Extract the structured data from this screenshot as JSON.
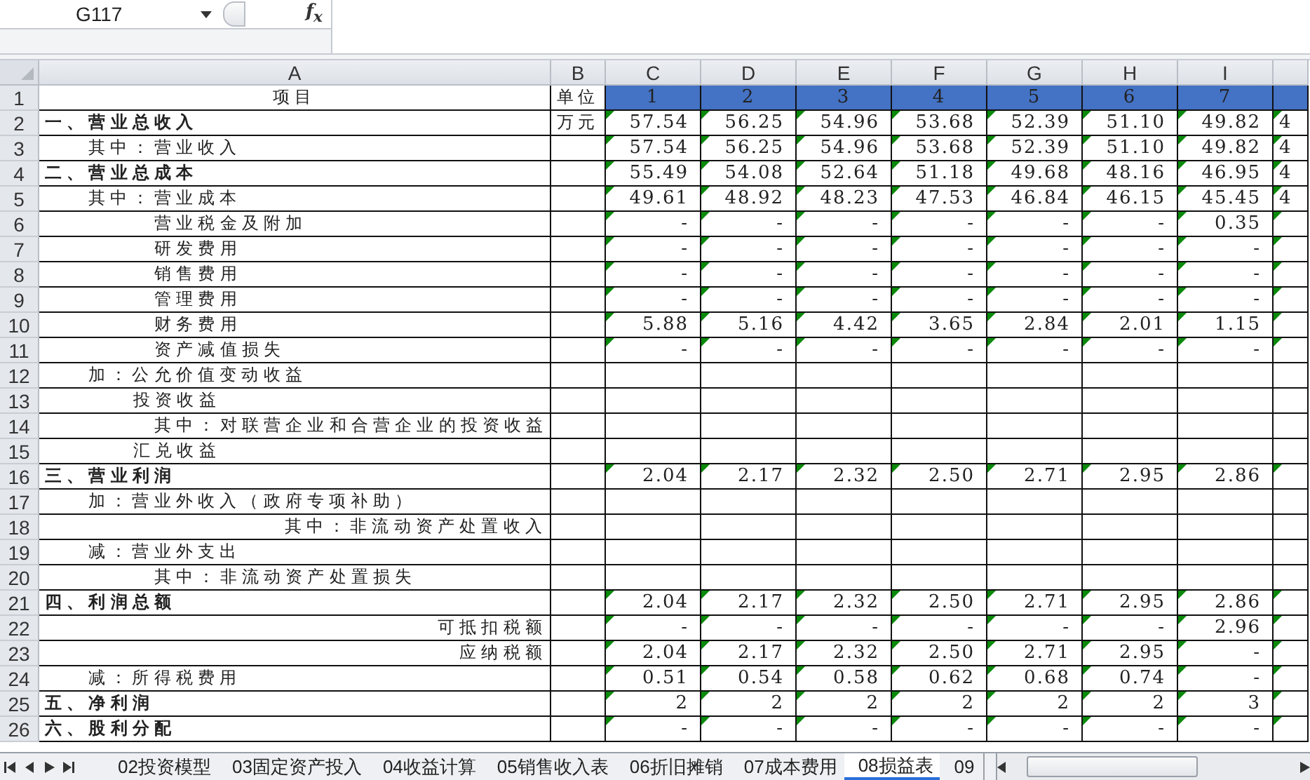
{
  "formula_bar": {
    "name_box": "G117",
    "function_label": "f$_{x}$"
  },
  "columns": [
    "A",
    "B",
    "C",
    "D",
    "E",
    "F",
    "G",
    "H",
    "I"
  ],
  "rows": [
    {
      "num": "1",
      "label": "项目",
      "kind": "header",
      "unit": "单位",
      "values": [
        "1",
        "2",
        "3",
        "4",
        "5",
        "6",
        "7"
      ],
      "flagged": false
    },
    {
      "num": "2",
      "label": "一、营业总收入",
      "kind": "heading",
      "unit": "万元",
      "values": [
        "57.54",
        "56.25",
        "54.96",
        "53.68",
        "52.39",
        "51.10",
        "49.82"
      ],
      "column_j": "4",
      "flagged": true
    },
    {
      "num": "3",
      "label": "其中：营业收入",
      "kind": "level1",
      "values": [
        "57.54",
        "56.25",
        "54.96",
        "53.68",
        "52.39",
        "51.10",
        "49.82"
      ],
      "column_j": "4",
      "flagged": true
    },
    {
      "num": "4",
      "label": "二、营业总成本",
      "kind": "heading",
      "values": [
        "55.49",
        "54.08",
        "52.64",
        "51.18",
        "49.68",
        "48.16",
        "46.95"
      ],
      "column_j": "4",
      "flagged": true
    },
    {
      "num": "5",
      "label": "其中：营业成本",
      "kind": "level1",
      "values": [
        "49.61",
        "48.92",
        "48.23",
        "47.53",
        "46.84",
        "46.15",
        "45.45"
      ],
      "column_j": "4",
      "flagged": true
    },
    {
      "num": "6",
      "label": "营业税金及附加",
      "kind": "level3",
      "values": [
        "-",
        "-",
        "-",
        "-",
        "-",
        "-",
        "0.35"
      ],
      "flagged": true
    },
    {
      "num": "7",
      "label": "研发费用",
      "kind": "level3",
      "values": [
        "-",
        "-",
        "-",
        "-",
        "-",
        "-",
        "-"
      ],
      "flagged": true
    },
    {
      "num": "8",
      "label": "销售费用",
      "kind": "level3",
      "values": [
        "-",
        "-",
        "-",
        "-",
        "-",
        "-",
        "-"
      ],
      "flagged": true
    },
    {
      "num": "9",
      "label": "管理费用",
      "kind": "level3",
      "values": [
        "-",
        "-",
        "-",
        "-",
        "-",
        "-",
        "-"
      ],
      "flagged": true
    },
    {
      "num": "10",
      "label": "财务费用",
      "kind": "level3",
      "values": [
        "5.88",
        "5.16",
        "4.42",
        "3.65",
        "2.84",
        "2.01",
        "1.15"
      ],
      "flagged": true
    },
    {
      "num": "11",
      "label": "资产减值损失",
      "kind": "level3",
      "values": [
        "-",
        "-",
        "-",
        "-",
        "-",
        "-",
        "-"
      ],
      "flagged": true
    },
    {
      "num": "12",
      "label": "加：公允价值变动收益",
      "kind": "level1",
      "flagged": false
    },
    {
      "num": "13",
      "label": "投资收益",
      "kind": "level2",
      "flagged": false
    },
    {
      "num": "14",
      "label": "其中：对联营企业和合营企业的投资收益",
      "kind": "level3",
      "flagged": false
    },
    {
      "num": "15",
      "label": "汇兑收益",
      "kind": "level2",
      "flagged": false
    },
    {
      "num": "16",
      "label": "三、营业利润",
      "kind": "heading",
      "values": [
        "2.04",
        "2.17",
        "2.32",
        "2.50",
        "2.71",
        "2.95",
        "2.86"
      ],
      "flagged": true
    },
    {
      "num": "17",
      "label": "加：营业外收入（政府专项补助）",
      "kind": "level1",
      "flagged": false
    },
    {
      "num": "18",
      "label": "其中：非流动资产处置收入",
      "kind": "right",
      "flagged": false
    },
    {
      "num": "19",
      "label": "减：营业外支出",
      "kind": "level1",
      "flagged": false
    },
    {
      "num": "20",
      "label": "其中：非流动资产处置损失",
      "kind": "level3",
      "flagged": false
    },
    {
      "num": "21",
      "label": "四、利润总额",
      "kind": "heading",
      "values": [
        "2.04",
        "2.17",
        "2.32",
        "2.50",
        "2.71",
        "2.95",
        "2.86"
      ],
      "flagged": true
    },
    {
      "num": "22",
      "label": "可抵扣税额",
      "kind": "right",
      "values": [
        "-",
        "-",
        "-",
        "-",
        "-",
        "-",
        "2.96"
      ],
      "flagged": true
    },
    {
      "num": "23",
      "label": "应纳税额",
      "kind": "right",
      "values": [
        "2.04",
        "2.17",
        "2.32",
        "2.50",
        "2.71",
        "2.95",
        "-"
      ],
      "flagged": true
    },
    {
      "num": "24",
      "label": "减：所得税费用",
      "kind": "level1",
      "values": [
        "0.51",
        "0.54",
        "0.58",
        "0.62",
        "0.68",
        "0.74",
        "-"
      ],
      "flagged": true
    },
    {
      "num": "25",
      "label": "五、净利润",
      "kind": "heading",
      "values": [
        "2",
        "2",
        "2",
        "2",
        "2",
        "2",
        "3"
      ],
      "flagged": true
    },
    {
      "num": "26",
      "label": "六、股利分配",
      "kind": "heading",
      "values": [
        "-",
        "-",
        "-",
        "-",
        "-",
        "-",
        "-"
      ],
      "flagged": true
    }
  ],
  "sheet_tabs": [
    {
      "label": "02投资模型",
      "selected": false
    },
    {
      "label": "03固定资产投入",
      "selected": false
    },
    {
      "label": "04收益计算",
      "selected": false
    },
    {
      "label": "05销售收入表",
      "selected": false
    },
    {
      "label": "06折旧摊销",
      "selected": false
    },
    {
      "label": "07成本费用",
      "selected": false
    },
    {
      "label": "08损益表",
      "selected": true
    },
    {
      "label": "09",
      "selected": false
    }
  ]
}
